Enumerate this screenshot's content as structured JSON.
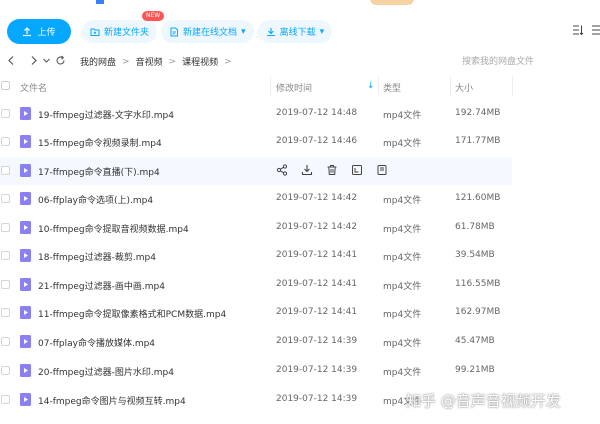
{
  "toolbar": {
    "upload_label": "上传",
    "new_folder_label": "新建文件夹",
    "new_online_doc_label": "新建在线文档",
    "new_badge": "NEW",
    "offline_download_label": "离线下载"
  },
  "nav": {
    "crumbs": [
      "我的网盘",
      "音视频",
      "课程视频"
    ],
    "search_placeholder": "搜索我的网盘文件"
  },
  "table": {
    "headers": {
      "name": "文件名",
      "modified": "修改时间",
      "type": "类型",
      "size": "大小"
    },
    "rows": [
      {
        "name": "19-ffmpeg过滤器-文字水印.mp4",
        "date": "2019-07-12 14:48",
        "type": "mp4文件",
        "size": "192.74MB"
      },
      {
        "name": "15-ffmpeg命令视频录制.mp4",
        "date": "2019-07-12 14:46",
        "type": "mp4文件",
        "size": "171.77MB"
      },
      {
        "name": "17-ffmpeg命令直播(下).mp4",
        "date": "",
        "type": "",
        "size": ""
      },
      {
        "name": "06-ffplay命令选项(上).mp4",
        "date": "2019-07-12 14:42",
        "type": "mp4文件",
        "size": "121.60MB"
      },
      {
        "name": "10-ffmpeg命令提取音视频数据.mp4",
        "date": "2019-07-12 14:42",
        "type": "mp4文件",
        "size": "61.78MB"
      },
      {
        "name": "18-ffmpeg过滤器-裁剪.mp4",
        "date": "2019-07-12 14:41",
        "type": "mp4文件",
        "size": "39.54MB"
      },
      {
        "name": "21-ffmpeg过滤器-画中画.mp4",
        "date": "2019-07-12 14:41",
        "type": "mp4文件",
        "size": "116.55MB"
      },
      {
        "name": "11-ffmpeg命令提取像素格式和PCM数据.mp4",
        "date": "2019-07-12 14:41",
        "type": "mp4文件",
        "size": "162.97MB"
      },
      {
        "name": "07-ffplay命令播放媒体.mp4",
        "date": "2019-07-12 14:39",
        "type": "mp4文件",
        "size": "45.47MB"
      },
      {
        "name": "20-ffmpeg过滤器-图片水印.mp4",
        "date": "2019-07-12 14:39",
        "type": "mp4文件",
        "size": "99.21MB"
      },
      {
        "name": "14-fmpeg命令图片与视频互转.mp4",
        "date": "2019-07-12 14:39",
        "type": "mp4文件",
        "size": ""
      }
    ]
  },
  "watermark": "知乎 @音声音视频开发",
  "colors": {
    "accent": "#06a7ff",
    "file_icon": "#8b7ff4",
    "hover_row": "#f3f9ff"
  }
}
